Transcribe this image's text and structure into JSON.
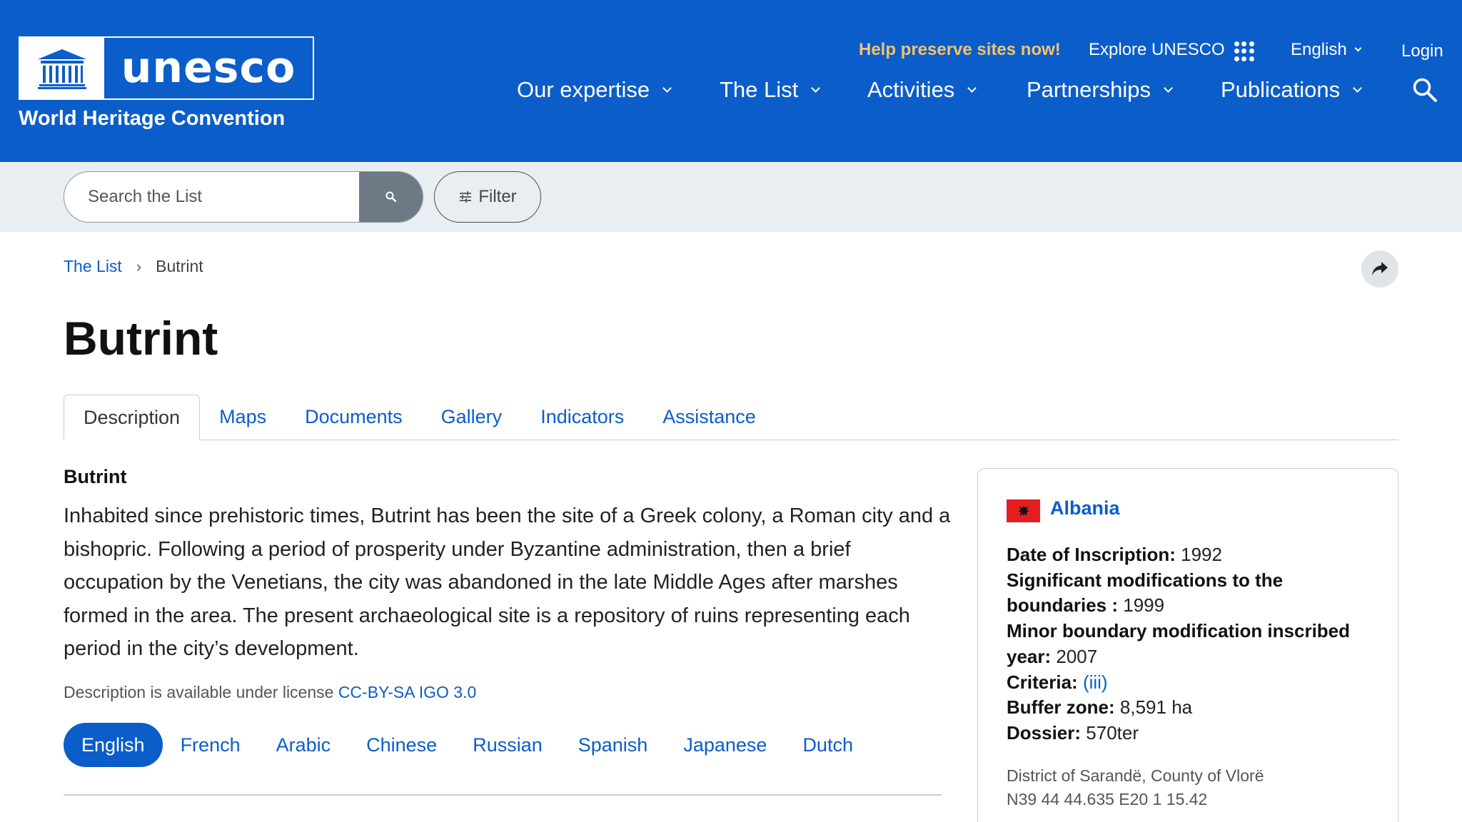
{
  "header": {
    "logo_word": "unesco",
    "logo_subtitle": "World Heritage Convention",
    "help_link": "Help preserve sites now!",
    "explore": "Explore UNESCO",
    "language": "English",
    "login": "Login",
    "nav": [
      {
        "label": "Our expertise"
      },
      {
        "label": "The List"
      },
      {
        "label": "Activities"
      },
      {
        "label": "Partnerships"
      },
      {
        "label": "Publications"
      }
    ],
    "colors": {
      "brand": "#0b5dca",
      "help": "#f3c36b"
    }
  },
  "search": {
    "placeholder": "Search the List",
    "filter_label": "Filter"
  },
  "breadcrumb": {
    "root": "The List",
    "current": "Butrint"
  },
  "page": {
    "title": "Butrint"
  },
  "tabs": [
    {
      "label": "Description",
      "active": true
    },
    {
      "label": "Maps"
    },
    {
      "label": "Documents"
    },
    {
      "label": "Gallery"
    },
    {
      "label": "Indicators"
    },
    {
      "label": "Assistance"
    }
  ],
  "description": {
    "heading": "Butrint",
    "text": "Inhabited since prehistoric times, Butrint has been the site of a Greek colony, a Roman city and a bishopric. Following a period of prosperity under Byzantine administration, then a brief occupation by the Venetians, the city was abandoned in the late Middle Ages after marshes formed in the area. The present archaeological site is a repository of ruins representing each period in the city’s development.",
    "license_prefix": "Description is available under license",
    "license_link": "CC-BY-SA IGO 3.0",
    "languages": [
      "English",
      "French",
      "Arabic",
      "Chinese",
      "Russian",
      "Spanish",
      "Japanese",
      "Dutch"
    ]
  },
  "info": {
    "country": "Albania",
    "inscription_label": "Date of Inscription:",
    "inscription_value": "1992",
    "sig_mod_label": "Significant modifications to the boundaries :",
    "sig_mod_value": "1999",
    "minor_mod_label": "Minor boundary modification inscribed year:",
    "minor_mod_value": "2007",
    "criteria_label": "Criteria:",
    "criteria_value": "(iii)",
    "buffer_label": "Buffer zone:",
    "buffer_value": "8,591 ha",
    "dossier_label": "Dossier:",
    "dossier_value": "570ter",
    "location": "District of Sarandë, County of Vlorë",
    "coordinates": "N39 44 44.635 E20 1 15.42"
  }
}
